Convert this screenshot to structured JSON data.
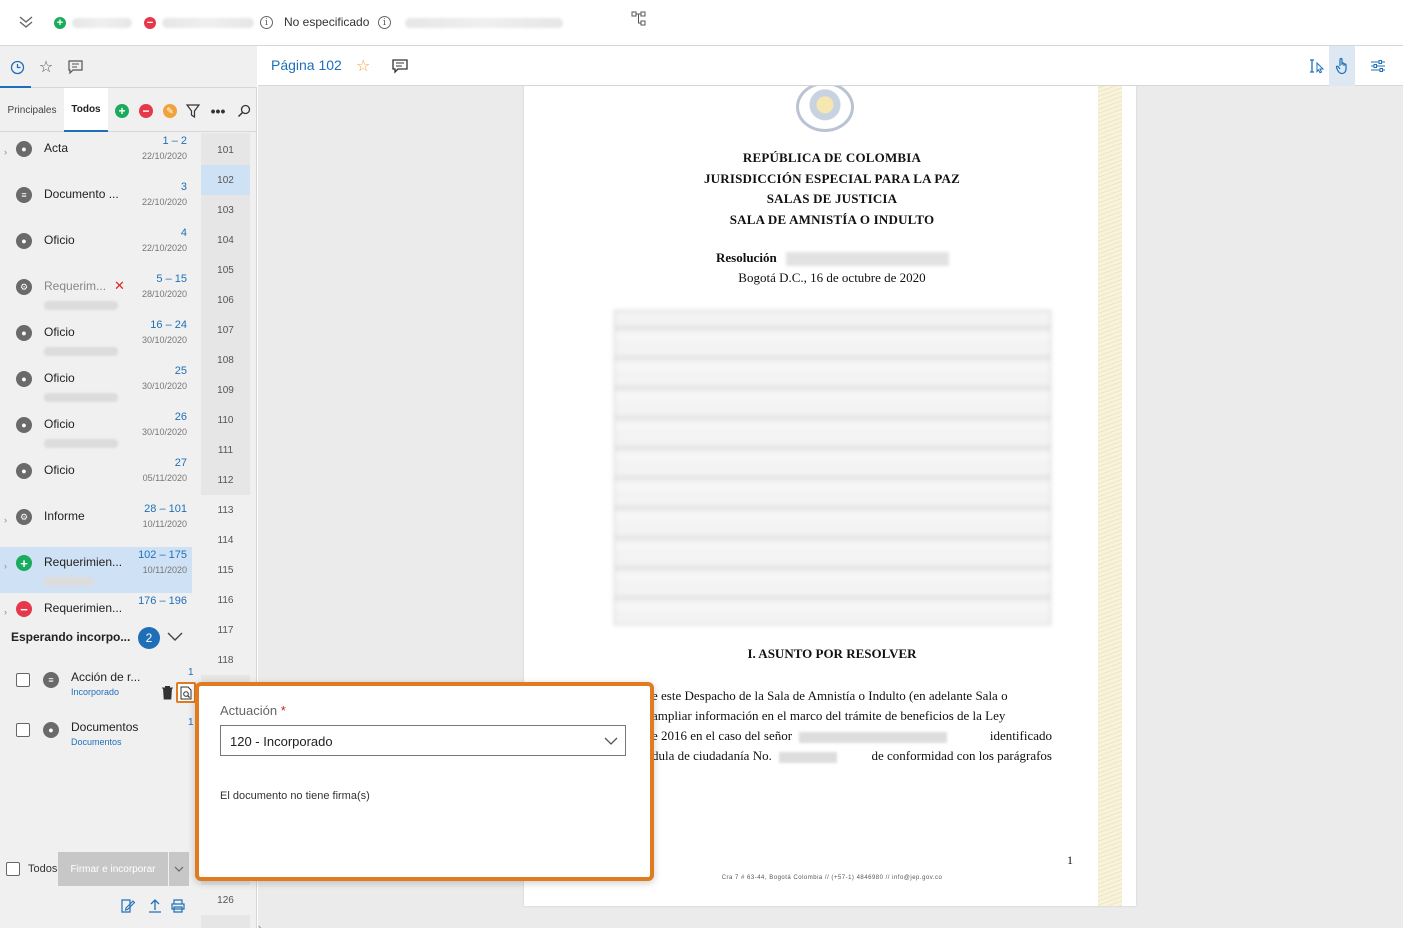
{
  "topbar": {
    "status_text": "No especificado"
  },
  "left_panel": {
    "tabs": [
      "Principales",
      "Todos"
    ],
    "documents": [
      {
        "title": "Acta",
        "range": "1 – 2",
        "date": "22/10/2020",
        "icon": "person-icon",
        "state": "normal"
      },
      {
        "title": "Documento ...",
        "range": "3",
        "date": "22/10/2020",
        "icon": "document-icon",
        "state": "normal"
      },
      {
        "title": "Oficio",
        "range": "4",
        "date": "22/10/2020",
        "icon": "person-icon",
        "state": "normal"
      },
      {
        "title": "Requerim...",
        "range": "5 – 15",
        "date": "28/10/2020",
        "icon": "person-gear-icon",
        "state": "rejected"
      },
      {
        "title": "Oficio",
        "range": "16 – 24",
        "date": "30/10/2020",
        "icon": "person-icon",
        "state": "normal"
      },
      {
        "title": "Oficio",
        "range": "25",
        "date": "30/10/2020",
        "icon": "person-icon",
        "state": "normal"
      },
      {
        "title": "Oficio",
        "range": "26",
        "date": "30/10/2020",
        "icon": "person-icon",
        "state": "normal"
      },
      {
        "title": "Oficio",
        "range": "27",
        "date": "05/11/2020",
        "icon": "person-icon",
        "state": "normal"
      },
      {
        "title": "Informe",
        "range": "28 – 101",
        "date": "10/11/2020",
        "icon": "person-gear-icon",
        "state": "normal"
      },
      {
        "title": "Requerimien...",
        "range": "102 – 175",
        "date": "10/11/2020",
        "icon": "plus-icon",
        "state": "selected"
      },
      {
        "title": "Requerimien...",
        "range": "176 – 196",
        "date": "",
        "icon": "minus-icon",
        "state": "normal"
      }
    ],
    "page_numbers": [
      "101",
      "102",
      "103",
      "104",
      "105",
      "106",
      "107",
      "108",
      "109",
      "110",
      "111",
      "112",
      "113",
      "114",
      "115",
      "116",
      "117",
      "118"
    ],
    "page_number_bottom": "126",
    "selected_page": "102",
    "waiting": {
      "title": "Esperando incorpo...",
      "count": "2"
    },
    "pending": [
      {
        "title": "Acción de r...",
        "subtitle": "Incorporado",
        "count": "1"
      },
      {
        "title": "Documentos",
        "subtitle": "Documentos",
        "count": "1"
      }
    ],
    "select_all_label": "Todos",
    "sign_button": "Firmar e incorporar"
  },
  "viewer_header": {
    "page_label": "Página 102"
  },
  "document": {
    "heading": [
      "REPÚBLICA DE COLOMBIA",
      "JURISDICCIÓN ESPECIAL PARA LA PAZ",
      "SALAS DE JUSTICIA",
      "SALA DE AMNISTÍA O INDULTO"
    ],
    "resolution_label": "Resolución",
    "date_line": "Bogotá D.C., 16 de octubre de 2020",
    "section_title": "I. ASUNTO POR RESOLVER",
    "body_lines": [
      "e este Despacho de la Sala de Amnistía o Indulto (en adelante Sala o",
      "ampliar información en el marco del trámite de beneficios de la Ley",
      "e 2016 en el caso del señor",
      "identificado",
      "dula de ciudadanía No.",
      "de conformidad con los parágrafos"
    ],
    "footer": "Cra 7 # 63-44, Bogotá Colombia // (+57-1) 4846980 // info@jep.gov.co",
    "page_number": "1"
  },
  "popover": {
    "label": "Actuación",
    "required_mark": "*",
    "select_value": "120 - Incorporado",
    "message": "El documento no tiene firma(s)"
  },
  "colors": {
    "accent": "#1f6fb8",
    "highlight": "#e07b1f",
    "success": "#1aab5d",
    "danger": "#e5394b"
  }
}
